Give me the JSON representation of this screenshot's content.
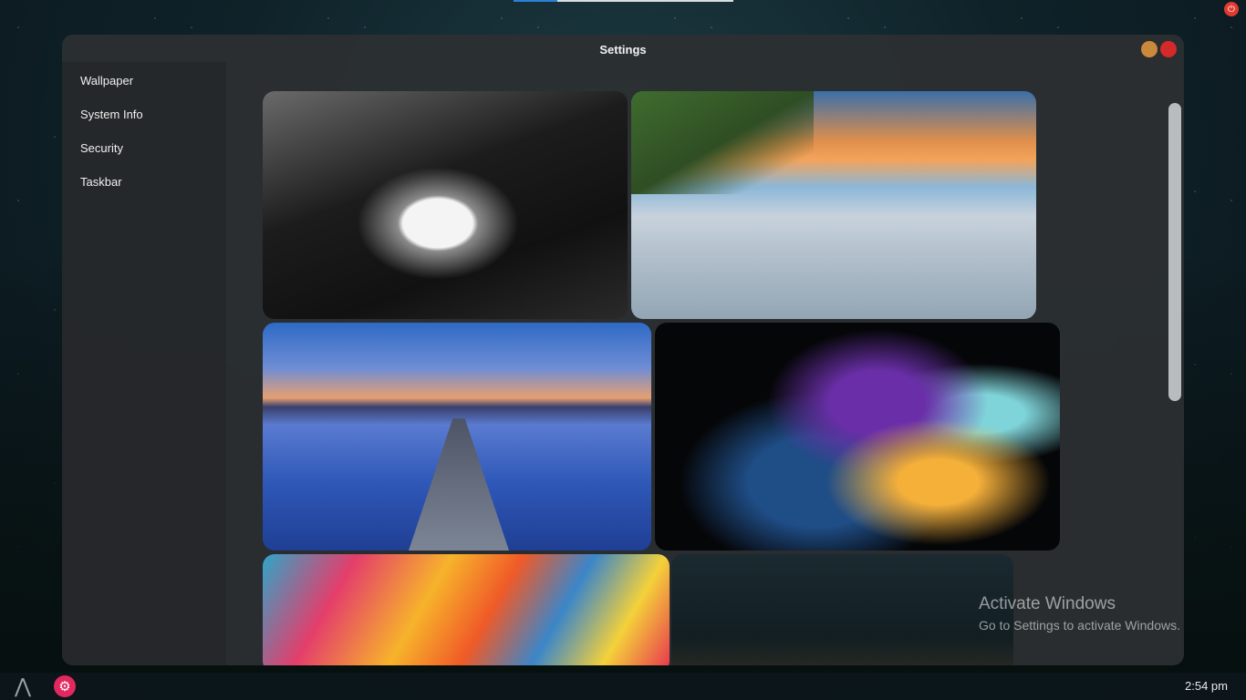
{
  "window": {
    "title": "Settings"
  },
  "sidebar": {
    "items": [
      {
        "label": "Wallpaper"
      },
      {
        "label": "System Info"
      },
      {
        "label": "Security"
      },
      {
        "label": "Taskbar"
      }
    ]
  },
  "wallpapers": [
    {
      "name": "white-wolf-wallpaper"
    },
    {
      "name": "beach-sunset-wallpaper"
    },
    {
      "name": "lake-pier-wallpaper"
    },
    {
      "name": "abstract-fluid-wallpaper"
    },
    {
      "name": "colorful-paint-wallpaper"
    },
    {
      "name": "night-sky-wallpaper"
    }
  ],
  "watermark": {
    "heading": "Activate Windows",
    "subtext": "Go to Settings to activate Windows."
  },
  "taskbar": {
    "launcher_glyph": "⋀",
    "settings_glyph": "⚙",
    "clock": "2:54 pm"
  },
  "system": {
    "power_glyph": "⏻"
  },
  "colors": {
    "accent": "#2e7fd6",
    "close": "#d42a2a",
    "minimize": "#c98a3b",
    "settings_app": "#e2285e"
  }
}
